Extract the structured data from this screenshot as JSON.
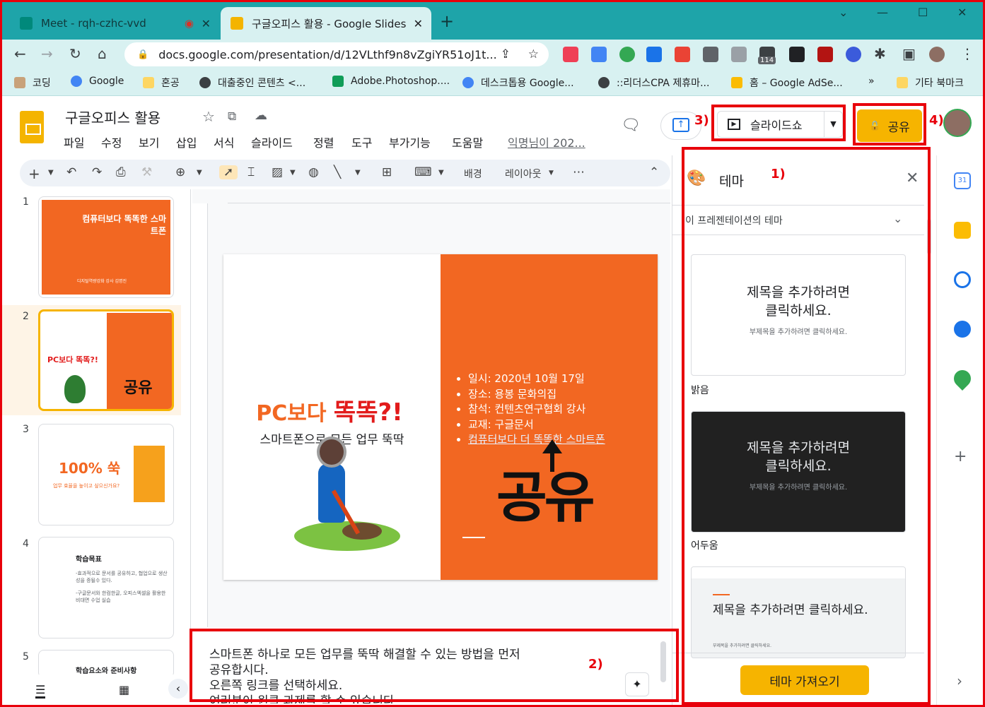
{
  "browser": {
    "tabs": [
      {
        "title": "Meet - rqh-czhc-vvd"
      },
      {
        "title": "구글오피스 활용 - Google Slides"
      }
    ],
    "new_tab": "+",
    "url": "docs.google.com/presentation/d/12VLthf9n8vZgiYR51oJ1t...",
    "bookmarks": [
      "코딩",
      "Google",
      "혼공",
      "대출중인 콘텐츠 <...",
      "Adobe.Photoshop....",
      "데스크톱용 Google...",
      "::리더스CPA 제휴마...",
      "홈 – Google AdSe...",
      "»",
      "기타 북마크"
    ],
    "extension_badge": "114"
  },
  "doc": {
    "title": "구글오피스 활용",
    "menus": [
      "파일",
      "수정",
      "보기",
      "삽입",
      "서식",
      "슬라이드",
      "정렬",
      "도구",
      "부가기능",
      "도움말"
    ],
    "last_edit": "익명님이 202...",
    "slideshow_label": "슬라이드쇼",
    "share_label": "공유"
  },
  "toolbar": {
    "background_label": "배경",
    "layout_label": "레이아웃"
  },
  "filmstrip": {
    "numbers": [
      "1",
      "2",
      "3",
      "4",
      "5"
    ],
    "slide1_title": "컴퓨터보다 똑똑한 스마트폰",
    "slide1_author": "디지털역량강화 강사 김명진",
    "slide2_title": "PC보다 똑똑?!",
    "slide2_big": "공유",
    "slide3_title": "100% 쑥",
    "slide3_sub": "업무 효율을 높이고 싶으신가요?",
    "slide4_title": "학습목표",
    "slide4_body1": "-효과적으로 문서를 공유하고, 협업으로 생산성을 증될수 있다.",
    "slide4_body2": "-구글문서와 한컴한글, 오피스엑셀을 활용한 비대면 수업 실습",
    "slide5_title": "학습요소와 준비사항"
  },
  "slide": {
    "title_part1": "PC보다 ",
    "title_part2": "똑똑?!",
    "subtitle": "스마트폰으로 모든 업무 뚝딱",
    "bullets": [
      "일시: 2020년 10월 17일",
      "장소: 용봉 문화의집",
      "참석: 컨텐츠연구협회 강사",
      "교재: 구글문서"
    ],
    "link_bullet": "컴퓨터보다 더 똑똑한 스마트폰",
    "big_text": "공유"
  },
  "notes": {
    "lines": [
      "스마트폰 하나로 모든 업무를 뚝딱 해결할 수 있는 방법을 먼저",
      "공유합시다.",
      "오른쪽 링크를 선택하세요.",
      "여러분이 원클 과제를 할 수 있습니다"
    ]
  },
  "theme_panel": {
    "title": "테마",
    "section": "이 프레젠테이션의 테마",
    "card_title": "제목을 추가하려면\n클릭하세요.",
    "card_sub": "부제목을 추가하려면 클릭하세요.",
    "card3_title": "제목을 추가하려면 클릭하세요.",
    "card3_sub": "부제목을 추가하려면 클릭하세요.",
    "names": [
      "밝음",
      "어두움"
    ],
    "import_label": "테마 가져오기"
  },
  "annotations": {
    "label1": "1)",
    "label2": "2)",
    "label3": "3)",
    "label4": "4)"
  },
  "colors": {
    "accent_orange": "#f26722",
    "share_yellow": "#f6b400",
    "annotation_red": "#e8000b"
  }
}
